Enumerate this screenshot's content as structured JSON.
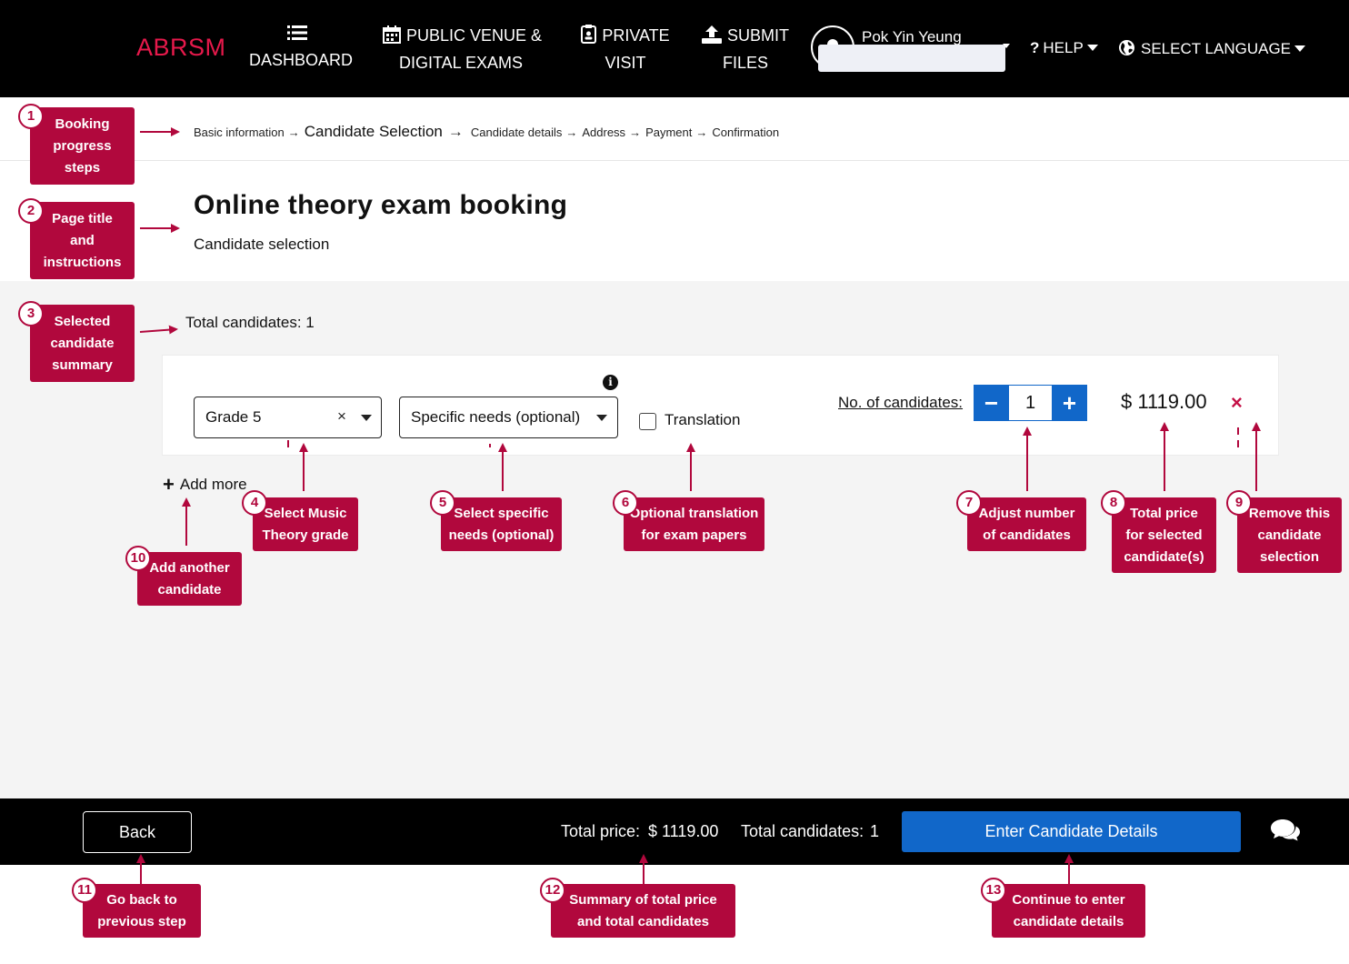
{
  "nav": {
    "logo": "ABRSM",
    "dashboard": "DASHBOARD",
    "public_line1": "PUBLIC VENUE &",
    "public_line2": "DIGITAL EXAMS",
    "private_line1": "PRIVATE",
    "private_line2": "VISIT",
    "submit_line1": "SUBMIT",
    "submit_line2": "FILES",
    "user_name": "Pok Yin Yeung",
    "help": "HELP",
    "language": "SELECT LANGUAGE"
  },
  "breadcrumb": [
    "Basic information",
    "Candidate Selection",
    "Candidate details",
    "Address",
    "Payment",
    "Confirmation"
  ],
  "page": {
    "title": "Online theory exam booking",
    "subtitle": "Candidate selection",
    "total_candidates": "Total candidates: 1"
  },
  "card": {
    "grade_value": "Grade 5",
    "needs_value": "Specific needs (optional)",
    "translation_label": "Translation",
    "translation_checked": false,
    "no_candidates_label": "No. of candidates:",
    "minus": "−",
    "plus": "+",
    "count": "1",
    "price": "$ 1119.00",
    "remove": "×",
    "add_more": "Add more"
  },
  "bottom": {
    "back": "Back",
    "total_price_label": "Total price:",
    "total_price_value": "$ 1119.00",
    "total_candidates_label": "Total candidates:",
    "total_candidates_value": "1",
    "enter_button": "Enter Candidate Details"
  },
  "annotations": [
    {
      "num": "1",
      "lines": [
        "Booking",
        "progress",
        "steps"
      ]
    },
    {
      "num": "2",
      "lines": [
        "Page title",
        "and",
        "instructions"
      ]
    },
    {
      "num": "3",
      "lines": [
        "Selected",
        "candidate",
        "summary"
      ]
    },
    {
      "num": "4",
      "lines": [
        "Select Music",
        "Theory grade"
      ]
    },
    {
      "num": "5",
      "lines": [
        "Select specific",
        "needs (optional)"
      ]
    },
    {
      "num": "6",
      "lines": [
        "Optional translation",
        "for exam papers"
      ]
    },
    {
      "num": "7",
      "lines": [
        "Adjust number",
        "of candidates"
      ]
    },
    {
      "num": "8",
      "lines": [
        "Total price",
        "for selected",
        "candidate(s)"
      ]
    },
    {
      "num": "9",
      "lines": [
        "Remove this",
        "candidate",
        "selection"
      ]
    },
    {
      "num": "10",
      "lines": [
        "Add another",
        "candidate"
      ]
    },
    {
      "num": "11",
      "lines": [
        "Go back to",
        "previous step"
      ]
    },
    {
      "num": "12",
      "lines": [
        "Summary of total price",
        "and total candidates"
      ]
    },
    {
      "num": "13",
      "lines": [
        "Continue to enter",
        "candidate details"
      ]
    }
  ],
  "colors": {
    "brand_red": "#e6194b",
    "annotation": "#b1083d",
    "primary_blue": "#1167c9",
    "nav_bg": "#000000"
  }
}
